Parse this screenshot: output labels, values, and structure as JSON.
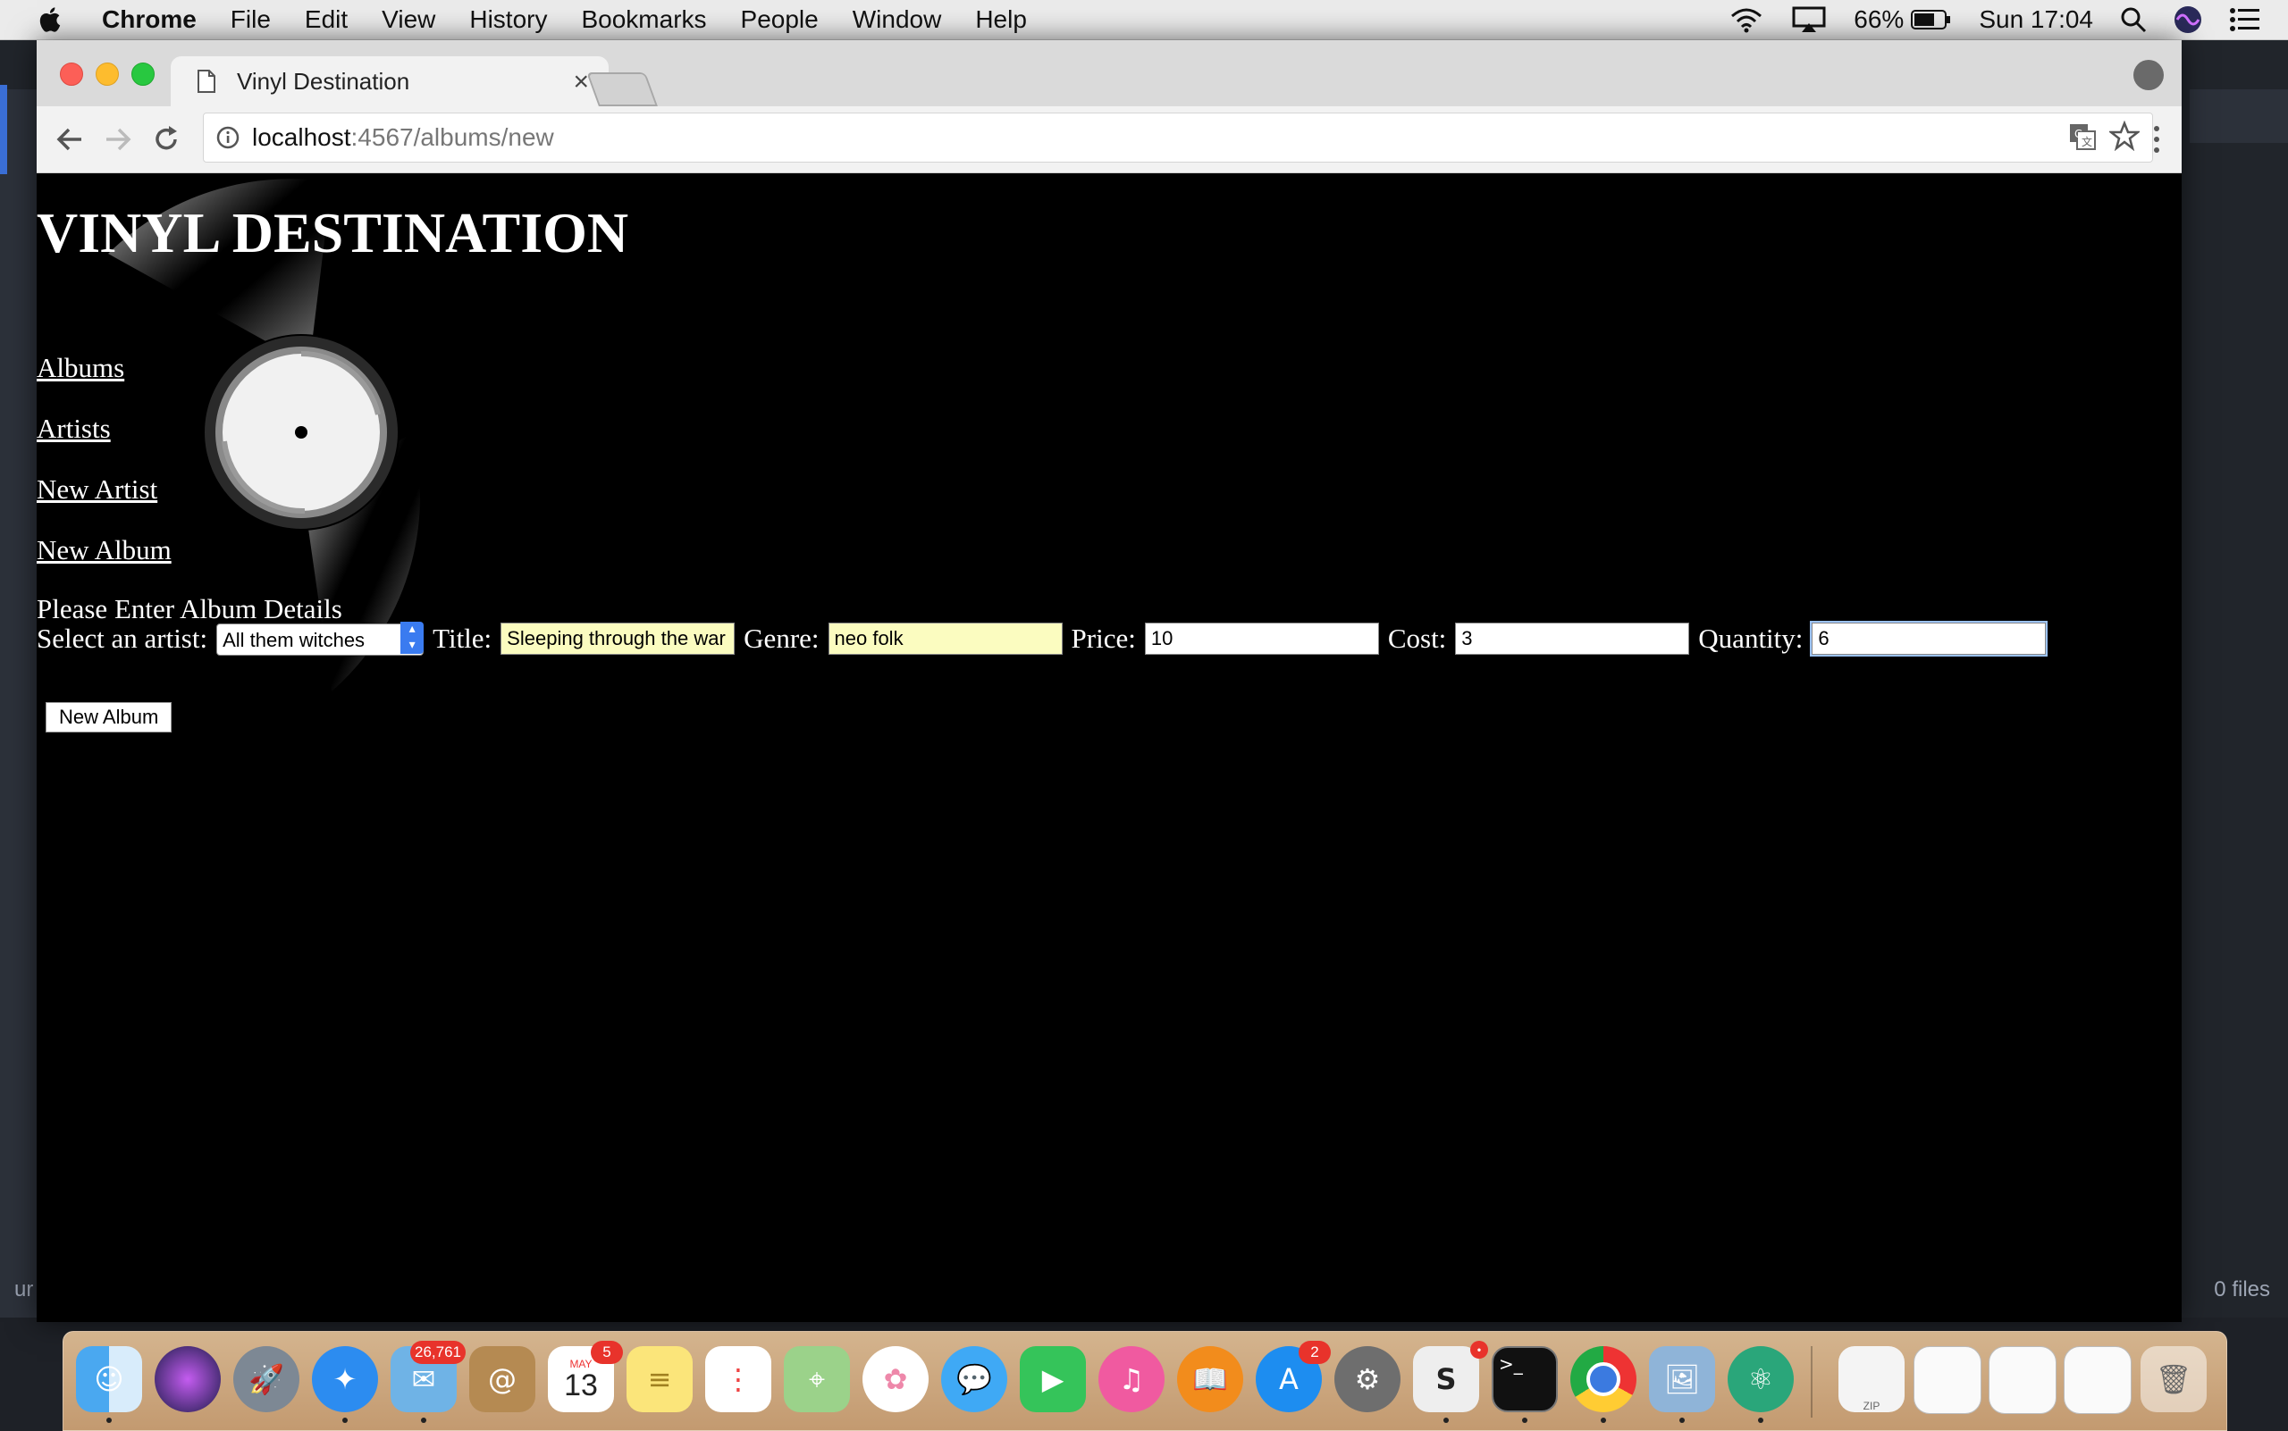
{
  "menubar": {
    "app_name": "Chrome",
    "items": [
      "File",
      "Edit",
      "View",
      "History",
      "Bookmarks",
      "People",
      "Window",
      "Help"
    ],
    "battery": "66%",
    "clock": "Sun 17:04"
  },
  "background_editor": {
    "status_left": "ur",
    "status_right": "0 files"
  },
  "browser": {
    "tab_title": "Vinyl Destination",
    "url_host": "localhost",
    "url_path": ":4567/albums/new"
  },
  "page": {
    "heading": "VINYL DESTINATION",
    "nav": {
      "albums": "Albums",
      "artists": "Artists",
      "new_artist": "New Artist",
      "new_album": "New Album"
    },
    "prompt": "Please Enter Album Details",
    "form": {
      "artist_label": "Select an artist:",
      "artist_selected": "All them witches",
      "title_label": "Title:",
      "title_value": "Sleeping through the war",
      "genre_label": "Genre:",
      "genre_value": "neo folk",
      "price_label": "Price:",
      "price_value": "10",
      "cost_label": "Cost:",
      "cost_value": "3",
      "quantity_label": "Quantity:",
      "quantity_value": "6",
      "submit_label": "New Album"
    }
  },
  "dock": {
    "mail_badge": "26,761",
    "calendar_month": "MAY",
    "calendar_day": "13",
    "calendar_badge": "5",
    "appstore_badge": "2",
    "zip_label": "ZIP"
  }
}
